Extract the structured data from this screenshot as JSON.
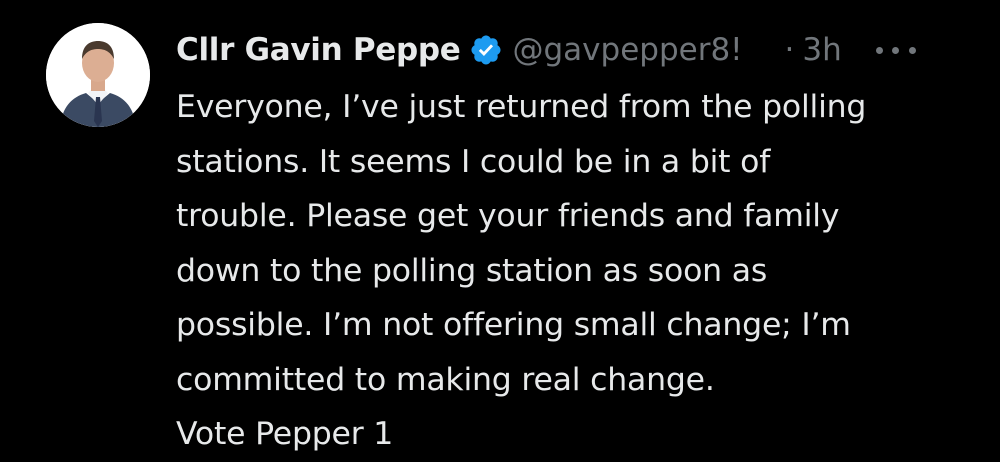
{
  "tweet": {
    "display_name": "Cllr Gavin Peppe",
    "handle": "@gavpepper8!",
    "separator": "·",
    "time": "3h",
    "verified": true,
    "verified_color": "#1d9bf0",
    "text": "Everyone, I’ve just returned from the polling\nstations. It seems I could be in a bit of\ntrouble. Please get your friends and family\ndown to the polling station as soon as\npossible. I’m not offering small change; I’m\ncommitted to making real change.\nVote Pepper 1"
  },
  "icons": {
    "verified": "verified-badge-icon",
    "more": "more-options-icon",
    "avatar": "profile-photo"
  },
  "colors": {
    "background": "#000000",
    "text": "#e7e9ea",
    "muted": "#71767b"
  }
}
